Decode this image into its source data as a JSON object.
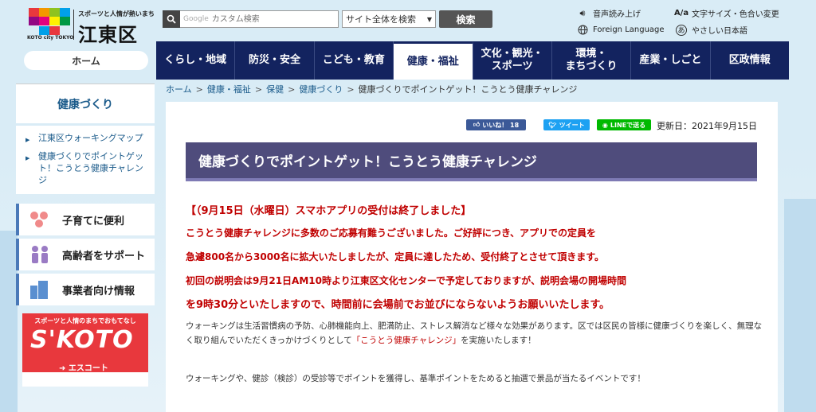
{
  "header": {
    "logo_tagline": "スポーツと人情が熱いまち",
    "logo_name": "江東区",
    "logo_sub": "KOTO city TOKYO",
    "search_placeholder": "カスタム検索",
    "search_brand": "Google",
    "scope_selected": "サイト全体を検索",
    "search_button": "検索",
    "utils": {
      "read_aloud": "音声読み上げ",
      "font_color": "文字サイズ・色合い変更",
      "foreign": "Foreign Language",
      "easy_jp": "やさしい日本語"
    }
  },
  "home_tab": "ホーム",
  "gnav": [
    {
      "label": "くらし・地域",
      "active": false
    },
    {
      "label": "防災・安全",
      "active": false
    },
    {
      "label": "こども・教育",
      "active": false
    },
    {
      "label": "健康・福祉",
      "active": true
    },
    {
      "label": "文化・観光・\nスポーツ",
      "active": false
    },
    {
      "label": "環境・\nまちづくり",
      "active": false
    },
    {
      "label": "産業・しごと",
      "active": false
    },
    {
      "label": "区政情報",
      "active": false
    }
  ],
  "sidebar": {
    "heading": "健康づくり",
    "links": [
      "江東区ウォーキングマップ",
      "健康づくりでポイントゲット！こうとう健康チャレンジ"
    ],
    "banners": [
      {
        "label": "子育てに便利",
        "icon": "family-icon"
      },
      {
        "label": "高齢者をサポート",
        "icon": "elderly-icon"
      },
      {
        "label": "事業者向け情報",
        "icon": "building-icon"
      }
    ],
    "skoto": {
      "tagline": "スポーツと人情のまちでおもてなし",
      "logo": "S'KOTO",
      "escort": "➜ エスコート"
    }
  },
  "breadcrumb": [
    "ホーム",
    "健康・福祉",
    "保健",
    "健康づくり",
    "健康づくりでポイントゲット！こうとう健康チャレンジ"
  ],
  "share": {
    "like": "いいね！ 18",
    "tweet": "ツイート",
    "line": "LINEで送る"
  },
  "updated": "更新日：2021年9月15日",
  "title": "健康づくりでポイントゲット！こうとう健康チャレンジ",
  "notices": [
    "【（9月15日（水曜日）スマホアプリの受付は終了しました】",
    "こうとう健康チャレンジに多数のご応募有難うございました。ご好評につき、アプリでの定員を",
    "急遽800名から3000名に拡大いたしましたが、定員に達したため、受付終了とさせて頂きます。",
    "初回の説明会は9月21日AM10時より江東区文化センターで予定しておりますが、説明会場の開場時間",
    "を9時30分といたしますので、時間前に会場前でお並びにならないようお願いいたします。"
  ],
  "body": {
    "p1_before": "ウォーキングは生活習慣病の予防、心肺機能向上、肥満防止、ストレス解消など様々な効果があります。区では区民の皆様に健康づくりを楽しく、無理なく取り組んでいただくきっかけづくりとして",
    "p1_highlight": "「こうとう健康チャレンジ」",
    "p1_after": "を実施いたします！",
    "p2": "ウォーキングや、健診（検診）の受診等でポイントを獲得し、基準ポイントをためると抽選で景品が当たるイベントです！"
  },
  "colors": {
    "nav_bg": "#13235f",
    "title_bg": "#4f4c7c",
    "notice_red": "#c00000",
    "link_blue": "#1a5a8a"
  }
}
